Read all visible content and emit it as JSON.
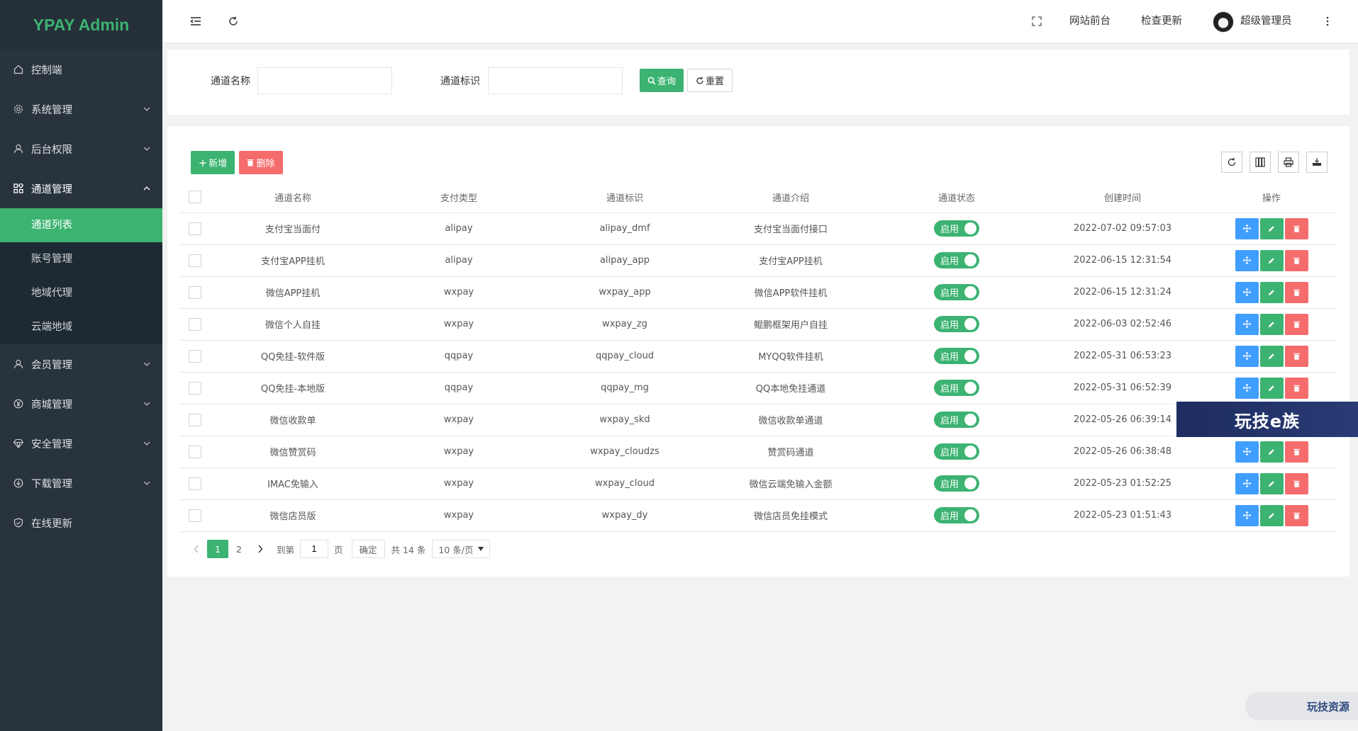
{
  "app": {
    "title": "YPAY Admin"
  },
  "sidebar": {
    "items": [
      {
        "label": "控制端",
        "icon": "home-icon",
        "expandable": false
      },
      {
        "label": "系统管理",
        "icon": "gear-icon",
        "expandable": true
      },
      {
        "label": "后台权限",
        "icon": "user-icon",
        "expandable": true
      },
      {
        "label": "通道管理",
        "icon": "apps-icon",
        "expandable": true,
        "open": true,
        "children": [
          {
            "label": "通道列表",
            "active": true
          },
          {
            "label": "账号管理"
          },
          {
            "label": "地域代理"
          },
          {
            "label": "云端地域"
          }
        ]
      },
      {
        "label": "会员管理",
        "icon": "user-icon",
        "expandable": true
      },
      {
        "label": "商城管理",
        "icon": "yen-icon",
        "expandable": true
      },
      {
        "label": "安全管理",
        "icon": "diamond-icon",
        "expandable": true
      },
      {
        "label": "下载管理",
        "icon": "download-icon",
        "expandable": true
      },
      {
        "label": "在线更新",
        "icon": "shield-check-icon",
        "expandable": false
      }
    ]
  },
  "header": {
    "links": {
      "frontend": "网站前台",
      "check_update": "检查更新"
    },
    "user": {
      "name": "超级管理员"
    }
  },
  "search": {
    "channel_name_label": "通道名称",
    "channel_name_value": "",
    "channel_id_label": "通道标识",
    "channel_id_value": "",
    "query_label": "查询",
    "reset_label": "重置"
  },
  "toolbar": {
    "add_label": "新增",
    "delete_label": "删除"
  },
  "table": {
    "columns": [
      "通道名称",
      "支付类型",
      "通道标识",
      "通道介绍",
      "通道状态",
      "创建时间",
      "操作"
    ],
    "rows": [
      {
        "name": "支付宝当面付",
        "type": "alipay",
        "code": "alipay_dmf",
        "desc": "支付宝当面付接口",
        "status": "启用",
        "created": "2022-07-02 09:57:03"
      },
      {
        "name": "支付宝APP挂机",
        "type": "alipay",
        "code": "alipay_app",
        "desc": "支付宝APP挂机",
        "status": "启用",
        "created": "2022-06-15 12:31:54"
      },
      {
        "name": "微信APP挂机",
        "type": "wxpay",
        "code": "wxpay_app",
        "desc": "微信APP软件挂机",
        "status": "启用",
        "created": "2022-06-15 12:31:24"
      },
      {
        "name": "微信个人自挂",
        "type": "wxpay",
        "code": "wxpay_zg",
        "desc": "鲲鹏框架用户自挂",
        "status": "启用",
        "created": "2022-06-03 02:52:46"
      },
      {
        "name": "QQ免挂-软件版",
        "type": "qqpay",
        "code": "qqpay_cloud",
        "desc": "MYQQ软件挂机",
        "status": "启用",
        "created": "2022-05-31 06:53:23"
      },
      {
        "name": "QQ免挂-本地版",
        "type": "qqpay",
        "code": "qqpay_mg",
        "desc": "QQ本地免挂通道",
        "status": "启用",
        "created": "2022-05-31 06:52:39"
      },
      {
        "name": "微信收款单",
        "type": "wxpay",
        "code": "wxpay_skd",
        "desc": "微信收款单通道",
        "status": "启用",
        "created": "2022-05-26 06:39:14"
      },
      {
        "name": "微信赞赏码",
        "type": "wxpay",
        "code": "wxpay_cloudzs",
        "desc": "赞赏码通道",
        "status": "启用",
        "created": "2022-05-26 06:38:48"
      },
      {
        "name": "IMAC免输入",
        "type": "wxpay",
        "code": "wxpay_cloud",
        "desc": "微信云端免输入金额",
        "status": "启用",
        "created": "2022-05-23 01:52:25"
      },
      {
        "name": "微信店员版",
        "type": "wxpay",
        "code": "wxpay_dy",
        "desc": "微信店员免挂模式",
        "status": "启用",
        "created": "2022-05-23 01:51:43"
      }
    ]
  },
  "pager": {
    "pages": [
      "1",
      "2"
    ],
    "current": "1",
    "goto_label": "到第",
    "goto_value": "1",
    "page_unit": "页",
    "confirm_label": "确定",
    "total_text": "共 14 条",
    "page_size": "10 条/页"
  },
  "watermarks": {
    "banner": "玩技e族",
    "corner": "玩技资源"
  },
  "colors": {
    "accent": "#3cb371",
    "sidebar": "#28333e",
    "danger": "#f56c6c",
    "info": "#409eff"
  }
}
